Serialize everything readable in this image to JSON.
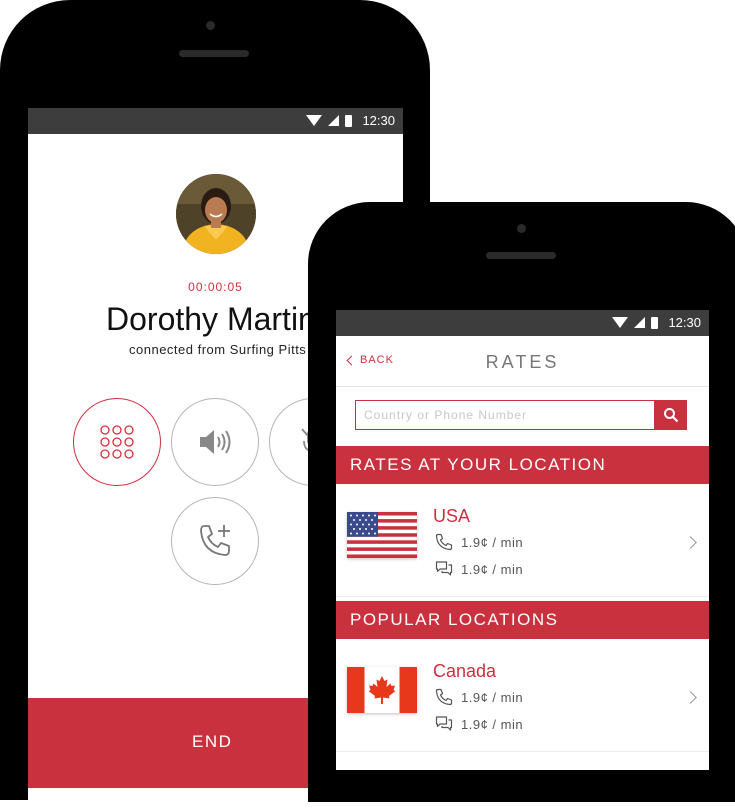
{
  "call_screen": {
    "status_time": "12:30",
    "timer": "00:00:05",
    "caller_name": "Dorothy Martin",
    "connection_text": "connected from Surfing Pitts",
    "buttons": [
      "keypad-icon",
      "speaker-icon",
      "mute-icon",
      "add-call-icon"
    ],
    "end_label": "END"
  },
  "rates_screen": {
    "status_time": "12:30",
    "back_label": "BACK",
    "title": "RATES",
    "search": {
      "placeholder": "Country or Phone Number"
    },
    "sections": [
      {
        "header": "RATES AT YOUR LOCATION",
        "items": [
          {
            "country": "USA",
            "flag": "usa-flag",
            "call_rate": "1.9¢ / min",
            "message_rate": "1.9¢ / min"
          }
        ]
      },
      {
        "header": "POPULAR LOCATIONS",
        "items": [
          {
            "country": "Canada",
            "flag": "canada-flag",
            "call_rate": "1.9¢ / min",
            "message_rate": "1.9¢ / min"
          }
        ]
      }
    ]
  },
  "colors": {
    "accent_red": "#c9313f",
    "status_bar": "#3d3d3d",
    "phone_body": "#000000"
  }
}
